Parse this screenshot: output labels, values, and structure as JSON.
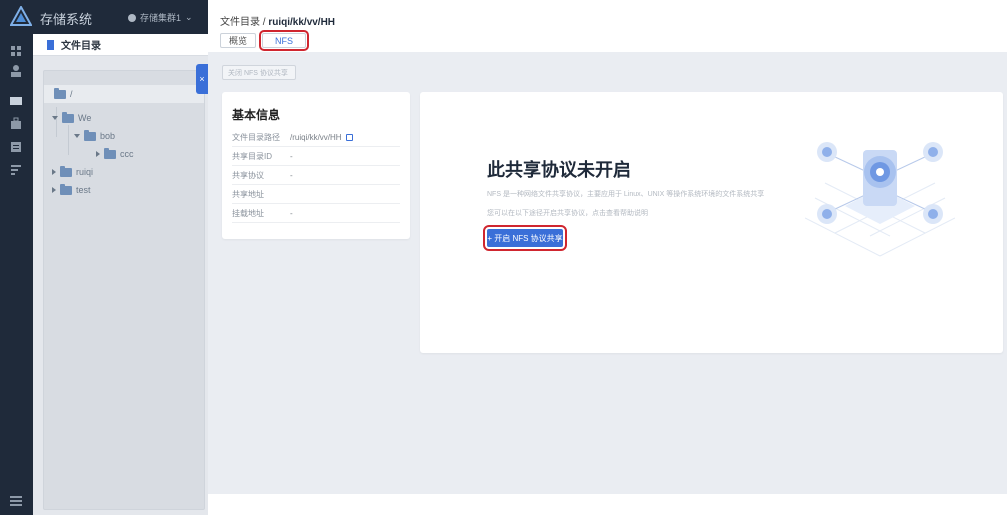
{
  "app": {
    "title": "存储系统",
    "user_label": "存储集群1"
  },
  "rail": {
    "icons": [
      "dashboard-icon",
      "user-icon",
      "storage-icon",
      "bag-icon",
      "server-icon",
      "list-icon",
      "menu-icon"
    ]
  },
  "directory": {
    "header": "文件目录",
    "root": "/",
    "tree": [
      {
        "label": "We"
      },
      {
        "label": "bob"
      },
      {
        "label": "ccc"
      },
      {
        "label": "ruiqi"
      },
      {
        "label": "test"
      }
    ]
  },
  "breadcrumb": {
    "prefix": "文件目录 / ",
    "current": "ruiqi/kk/vv/HH"
  },
  "tabs": [
    {
      "label": "概览"
    },
    {
      "label": "NFS"
    }
  ],
  "toolbar": {
    "close_nfs_label": "关闭 NFS 协议共享"
  },
  "basic_info": {
    "title": "基本信息",
    "rows": [
      {
        "key": "文件目录路径",
        "value": "/ruiqi/kk/vv/HH"
      },
      {
        "key": "共享目录ID",
        "value": "-"
      },
      {
        "key": "共享协议",
        "value": "-"
      },
      {
        "key": "共享地址",
        "value": ""
      },
      {
        "key": "挂载地址",
        "value": "-"
      }
    ]
  },
  "empty_state": {
    "title": "此共享协议未开启",
    "description": "NFS 是一种网络文件共享协议，主要应用于 Linux、UNIX 等操作系统环境的文件系统共享",
    "hint": "您可以在以下途径开启共享协议，点击查看帮助说明",
    "button_label": "+ 开启 NFS 协议共享"
  },
  "colors": {
    "accent": "#3a6fd8",
    "highlight": "#d0262f",
    "sidebar": "#1f2a3a"
  }
}
